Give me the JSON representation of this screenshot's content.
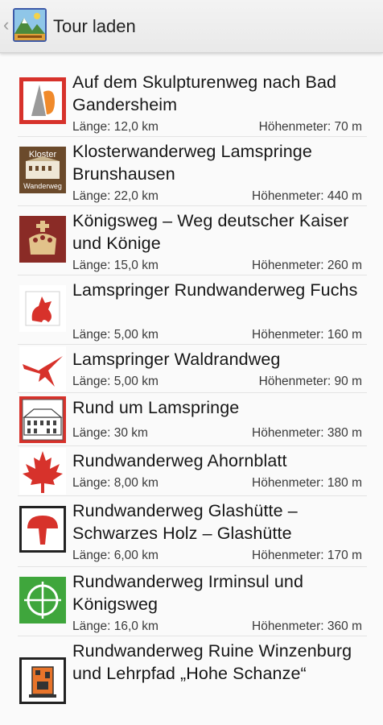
{
  "appbar": {
    "title": "Tour laden"
  },
  "tours": [
    {
      "title": "Auf dem Skulpturenweg nach Bad Gandersheim",
      "length": "Länge: 12,0 km",
      "elevation": "Höhenmeter: 70 m",
      "icon": "sculpture-icon"
    },
    {
      "title": "Klosterwanderweg Lamspringe Brunshausen",
      "length": "Länge: 22,0 km",
      "elevation": "Höhenmeter: 440 m",
      "icon": "kloster-wanderweg-icon",
      "icon_text": [
        "Kloster",
        "Wanderweg"
      ]
    },
    {
      "title": "Königsweg – Weg deutscher Kaiser und Könige",
      "length": "Länge: 15,0 km",
      "elevation": "Höhenmeter: 260 m",
      "icon": "crown-icon"
    },
    {
      "title": "Lamspringer Rundwanderweg Fuchs",
      "length": "Länge: 5,00 km",
      "elevation": "Höhenmeter: 160 m",
      "icon": "fox-icon"
    },
    {
      "title": "Lamspringer Waldrandweg",
      "length": "Länge: 5,00 km",
      "elevation": "Höhenmeter: 90 m",
      "icon": "bird-icon"
    },
    {
      "title": "Rund um Lamspringe",
      "length": "Länge: 30 km",
      "elevation": "Höhenmeter: 380 m",
      "icon": "building-icon"
    },
    {
      "title": "Rundwanderweg Ahornblatt",
      "length": "Länge: 8,00 km",
      "elevation": "Höhenmeter: 180 m",
      "icon": "maple-leaf-icon"
    },
    {
      "title": "Rundwanderweg Glashütte – Schwarzes Holz – Glashütte",
      "length": "Länge: 6,00 km",
      "elevation": "Höhenmeter: 170 m",
      "icon": "mushroom-icon"
    },
    {
      "title": "Rundwanderweg Irminsul und Königsweg",
      "length": "Länge: 16,0 km",
      "elevation": "Höhenmeter: 360 m",
      "icon": "irminsul-icon"
    },
    {
      "title": "Rundwanderweg Ruine Winzenburg und Lehrpfad „Hohe Schanze“",
      "length": "",
      "elevation": "",
      "icon": "ruin-icon"
    }
  ],
  "colors": {
    "appbar": "#ececec",
    "accent_red": "#d7322b",
    "accent_green": "#3fa63c",
    "brown": "#6b4a2b"
  }
}
